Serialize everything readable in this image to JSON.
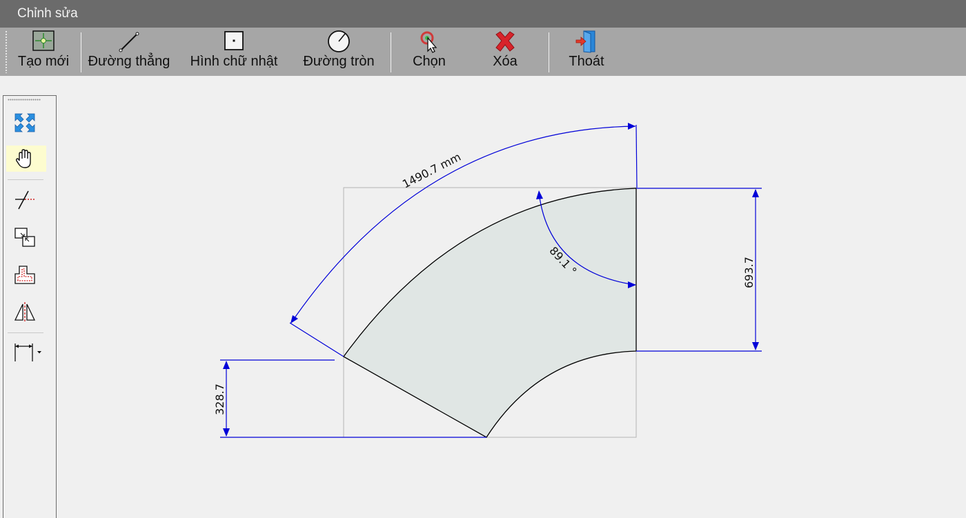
{
  "window": {
    "title": "Chỉnh sửa"
  },
  "toolbar": {
    "items": [
      {
        "label": "Tạo mới",
        "icon": "new-crosshair-icon"
      },
      {
        "label": "Đường thẳng",
        "icon": "line-icon"
      },
      {
        "label": "Hình chữ nhật",
        "icon": "rectangle-icon"
      },
      {
        "label": "Đường tròn",
        "icon": "circle-icon"
      },
      {
        "label": "Chọn",
        "icon": "select-cursor-icon"
      },
      {
        "label": "Xóa",
        "icon": "delete-x-icon"
      },
      {
        "label": "Thoát",
        "icon": "exit-door-icon"
      }
    ]
  },
  "side_tools": [
    {
      "icon": "zoom-extents-icon",
      "active": false
    },
    {
      "icon": "pan-hand-icon",
      "active": true
    },
    {
      "icon": "trim-line-icon",
      "active": false
    },
    {
      "icon": "snap-join-icon",
      "active": false
    },
    {
      "icon": "offset-shape-icon",
      "active": false
    },
    {
      "icon": "mirror-icon",
      "active": false
    },
    {
      "icon": "dimension-dropdown-icon",
      "active": false
    }
  ],
  "drawing": {
    "arc_length_label": "1490.7 mm",
    "angle_label": "89.1 °",
    "height_label": "693.7",
    "offset_label": "328.7",
    "colors": {
      "dimension": "#0000d8",
      "shape_fill": "#e0e6e4",
      "shape_stroke": "#000000",
      "bbox": "#b4b4b4"
    }
  }
}
